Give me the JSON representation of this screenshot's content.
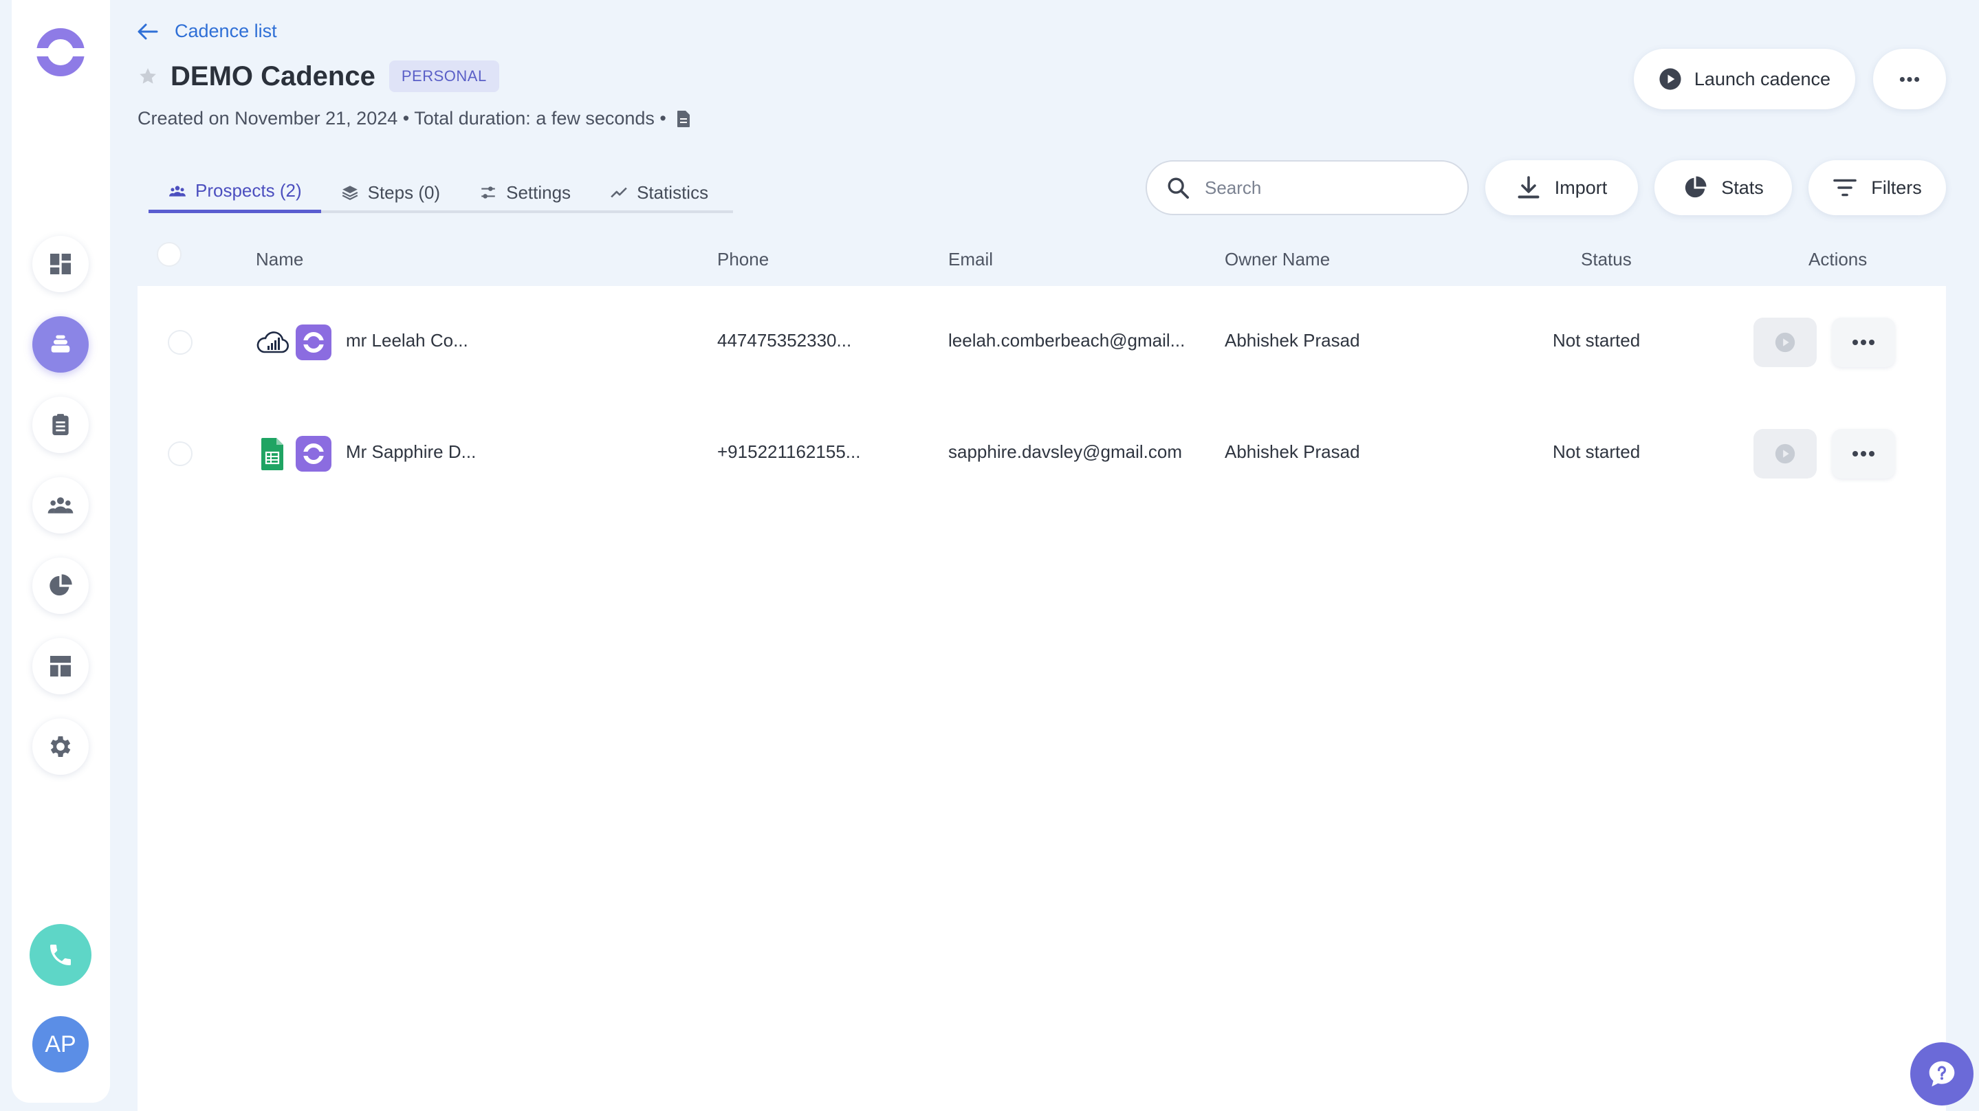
{
  "header": {
    "back_label": "Cadence list",
    "title": "DEMO Cadence",
    "badge": "PERSONAL",
    "meta": "Created on November 21, 2024 • Total duration: a few seconds •",
    "launch_label": "Launch cadence"
  },
  "tabs": [
    {
      "label": "Prospects (2)",
      "icon": "people-icon",
      "active": true
    },
    {
      "label": "Steps (0)",
      "icon": "layers-icon",
      "active": false
    },
    {
      "label": "Settings",
      "icon": "sliders-icon",
      "active": false
    },
    {
      "label": "Statistics",
      "icon": "trend-icon",
      "active": false
    }
  ],
  "search": {
    "placeholder": "Search",
    "value": ""
  },
  "toolbar": {
    "import_label": "Import",
    "stats_label": "Stats",
    "filters_label": "Filters"
  },
  "table": {
    "columns": [
      "Name",
      "Phone",
      "Email",
      "Owner Name",
      "Status",
      "Actions"
    ],
    "rows": [
      {
        "source_icon": "cloud-signal-icon",
        "name": "mr Leelah Co...",
        "phone": "447475352330...",
        "email": "leelah.comberbeach@gmail...",
        "owner": "Abhishek Prasad",
        "status": "Not started"
      },
      {
        "source_icon": "google-sheets-icon",
        "name": "Mr Sapphire D...",
        "phone": "+915221162155...",
        "email": "sapphire.davsley@gmail.com",
        "owner": "Abhishek Prasad",
        "status": "Not started"
      }
    ]
  },
  "sidebar": {
    "items": [
      {
        "icon": "dashboard-icon",
        "active": false
      },
      {
        "icon": "cadence-icon",
        "active": true
      },
      {
        "icon": "clipboard-icon",
        "active": false
      },
      {
        "icon": "people-icon",
        "active": false
      },
      {
        "icon": "pie-chart-icon",
        "active": false
      },
      {
        "icon": "layout-icon",
        "active": false
      },
      {
        "icon": "gear-icon",
        "active": false
      }
    ],
    "avatar_initials": "AP"
  },
  "colors": {
    "background": "#eef4fb",
    "accent": "#5a5dd0",
    "link": "#2f6fd6",
    "brand_purple": "#8b6ce0",
    "phone_teal": "#5ed6c7",
    "avatar_blue": "#5b8ee6"
  }
}
